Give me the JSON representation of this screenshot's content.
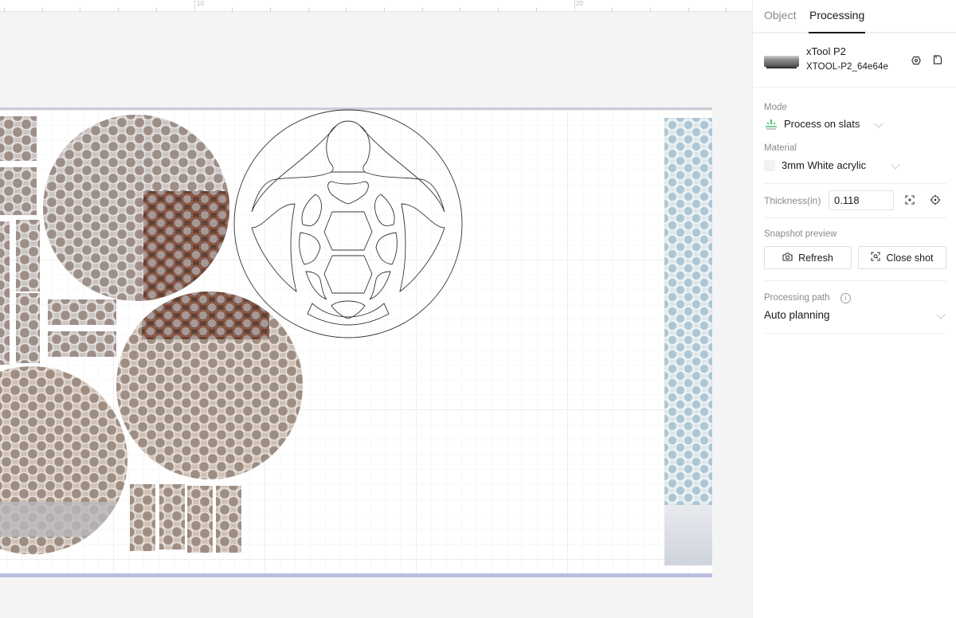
{
  "ruler": {
    "labels": [
      "10",
      "20"
    ]
  },
  "canvas": {
    "objects": [
      {
        "type": "image",
        "name": "honeycomb-strip-pieces"
      },
      {
        "type": "image",
        "name": "honeycomb-circle-top"
      },
      {
        "type": "image",
        "name": "honeycomb-circle-middle"
      },
      {
        "type": "image",
        "name": "honeycomb-circle-bottom-left"
      },
      {
        "type": "vector",
        "name": "sea-turtle-design"
      }
    ]
  },
  "panel": {
    "tabs": [
      {
        "label": "Object",
        "active": false
      },
      {
        "label": "Processing",
        "active": true
      }
    ],
    "device": {
      "name": "xTool P2",
      "id": "XTOOL-P2_64e64e",
      "icons": [
        "settings-icon",
        "save-icon"
      ]
    },
    "mode": {
      "label": "Mode",
      "value": "Process on slats",
      "icon": "slats-laser-icon",
      "icon_color": "#22b14c"
    },
    "material": {
      "label": "Material",
      "value": "3mm White acrylic"
    },
    "thickness": {
      "label": "Thickness(in)",
      "value": "0.118",
      "icons": [
        "autofocus-icon",
        "crosshair-icon"
      ]
    },
    "snapshot": {
      "label": "Snapshot preview",
      "refresh_label": "Refresh",
      "close_shot_label": "Close shot"
    },
    "processing_path": {
      "label": "Processing path",
      "value": "Auto planning"
    }
  }
}
